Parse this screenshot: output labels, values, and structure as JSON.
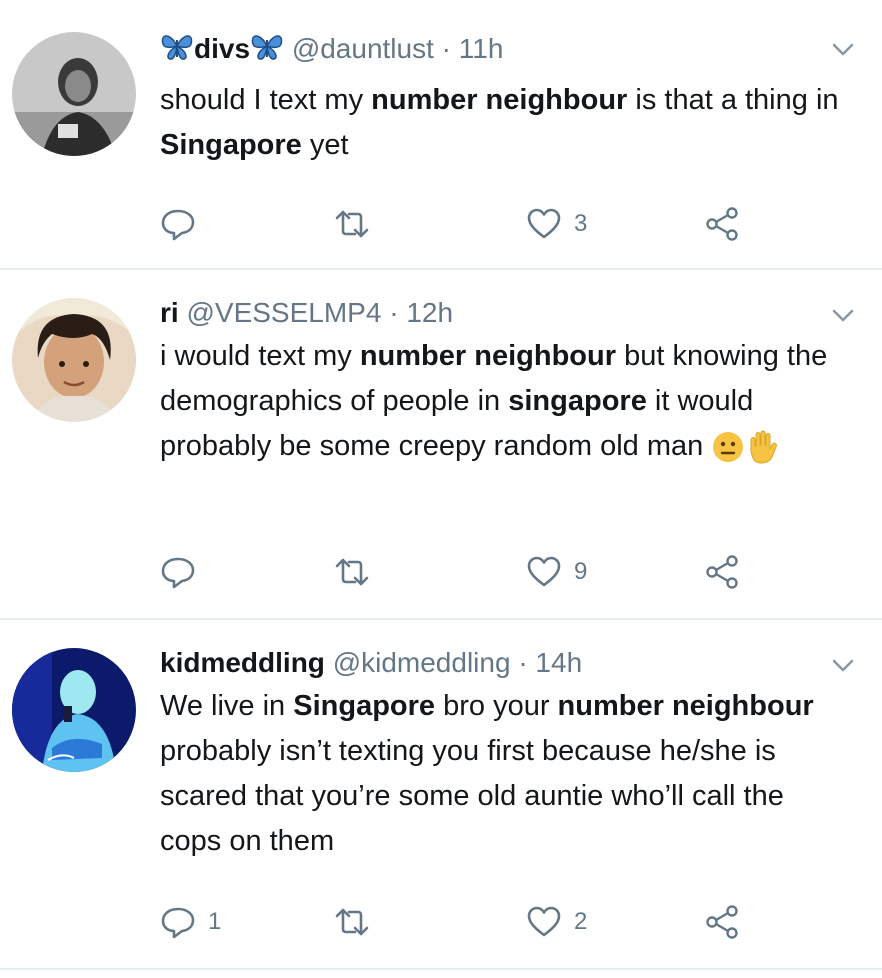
{
  "colors": {
    "text": "#14171a",
    "muted": "#657786",
    "divider": "#e6ecf0",
    "butterfly": "#4a90d9"
  },
  "tweets": [
    {
      "name": "divs",
      "handle": "@dauntlust",
      "separator": "·",
      "time": "11h",
      "segments": [
        {
          "text": "should I text my ",
          "bold": false
        },
        {
          "text": "number neighbour",
          "bold": true
        },
        {
          "text": " is that a thing in ",
          "bold": false
        },
        {
          "text": "Singapore",
          "bold": true
        },
        {
          "text": " yet",
          "bold": false
        }
      ],
      "emojis": [],
      "reply_count": "",
      "retweet_count": "",
      "like_count": "3"
    },
    {
      "name": "ri",
      "handle": "@VESSELMP4",
      "separator": "·",
      "time": "12h",
      "segments": [
        {
          "text": "i would text my ",
          "bold": false
        },
        {
          "text": "number neighbour",
          "bold": true
        },
        {
          "text": " but knowing the demographics of people in ",
          "bold": false
        },
        {
          "text": "singapore",
          "bold": true
        },
        {
          "text": " it would probably be some creepy random old man ",
          "bold": false
        }
      ],
      "emojis": [
        "neutral-face-emoji",
        "raised-hand-emoji"
      ],
      "reply_count": "",
      "retweet_count": "",
      "like_count": "9"
    },
    {
      "name": "kidmeddling",
      "handle": "@kidmeddling",
      "separator": "·",
      "time": "14h",
      "segments": [
        {
          "text": "We live in ",
          "bold": false
        },
        {
          "text": "Singapore",
          "bold": true
        },
        {
          "text": " bro your ",
          "bold": false
        },
        {
          "text": "number neighbour",
          "bold": true
        },
        {
          "text": " probably isn’t texting you first because he/she is scared that you’re some old auntie who’ll call the cops on them",
          "bold": false
        }
      ],
      "emojis": [],
      "reply_count": "1",
      "retweet_count": "",
      "like_count": "2"
    }
  ]
}
